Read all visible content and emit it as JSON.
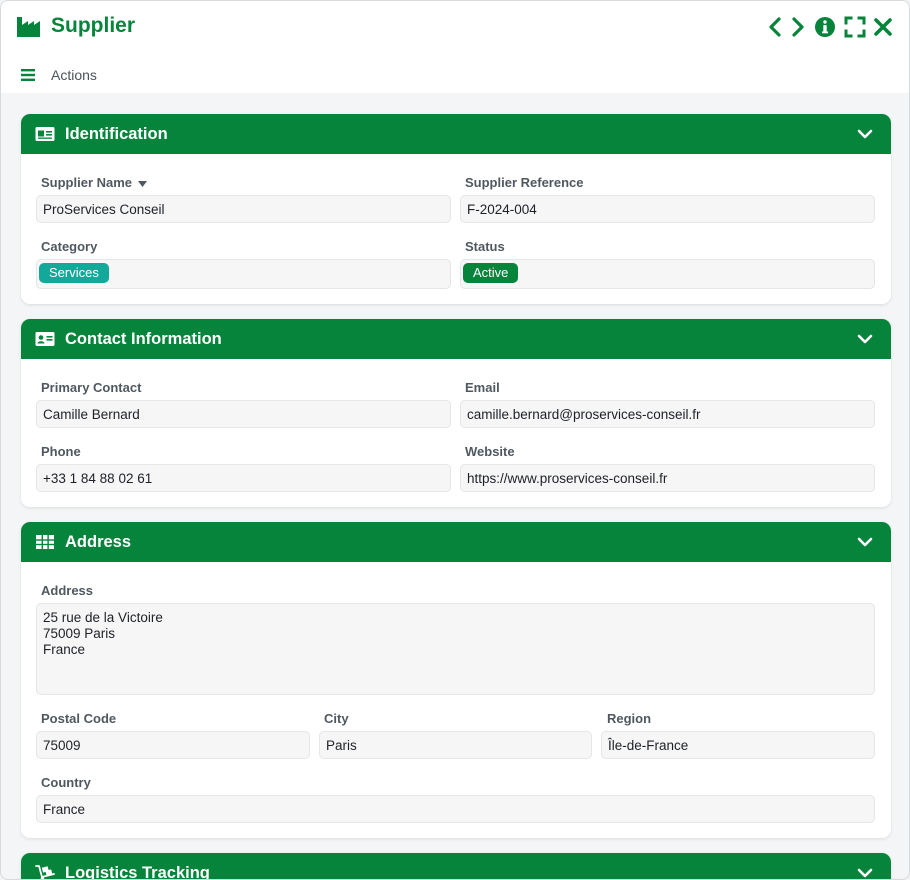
{
  "window": {
    "title": "Supplier"
  },
  "toolbar": {
    "actions_label": "Actions"
  },
  "sections": {
    "identification": {
      "title": "Identification",
      "supplier_name_label": "Supplier Name",
      "supplier_name_value": "ProServices Conseil",
      "supplier_reference_label": "Supplier Reference",
      "supplier_reference_value": "F-2024-004",
      "category_label": "Category",
      "category_value": "Services",
      "status_label": "Status",
      "status_value": "Active"
    },
    "contact": {
      "title": "Contact Information",
      "primary_contact_label": "Primary Contact",
      "primary_contact_value": "Camille Bernard",
      "email_label": "Email",
      "email_value": "camille.bernard@proservices-conseil.fr",
      "phone_label": "Phone",
      "phone_value": "+33 1 84 88 02 61",
      "website_label": "Website",
      "website_value": "https://www.proservices-conseil.fr"
    },
    "address": {
      "title": "Address",
      "address_label": "Address",
      "address_lines": [
        "25 rue de la Victoire",
        "75009 Paris",
        "France"
      ],
      "postal_code_label": "Postal Code",
      "postal_code_value": "75009",
      "city_label": "City",
      "city_value": "Paris",
      "region_label": "Region",
      "region_value": "Île-de-France",
      "country_label": "Country",
      "country_value": "France"
    },
    "logistics": {
      "title": "Logistics Tracking"
    }
  },
  "colors": {
    "brand_green": "#07843b",
    "badge_teal": "#12a99a",
    "badge_green": "#07843b"
  },
  "icons": {
    "app": "factory-icon",
    "prev": "chevron-left-icon",
    "next": "chevron-right-icon",
    "info": "info-icon",
    "fullscreen": "expand-icon",
    "close": "close-icon",
    "menu": "hamburger-icon",
    "identification": "id-card-icon",
    "contact": "contact-card-icon",
    "address": "grid-table-icon",
    "logistics": "dolly-icon",
    "collapse": "chevron-down-icon"
  }
}
